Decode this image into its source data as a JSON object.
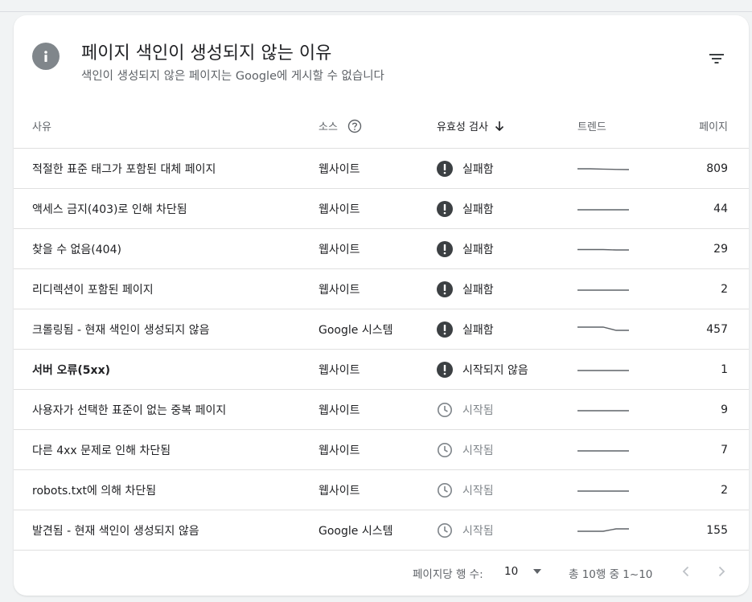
{
  "header": {
    "title": "페이지 색인이 생성되지 않는 이유",
    "subtitle": "색인이 생성되지 않은 페이지는 Google에 게시할 수 없습니다"
  },
  "columns": {
    "reason": "사유",
    "source": "소스",
    "validation": "유효성 검사",
    "trend": "트렌드",
    "pages": "페이지"
  },
  "rows": [
    {
      "reason": "적절한 표준 태그가 포함된 대체 페이지",
      "source": "웹사이트",
      "status": "실패함",
      "status_type": "failed",
      "pages": "809",
      "bold": false,
      "trend": [
        5,
        5,
        5.4,
        5.8,
        6
      ]
    },
    {
      "reason": "액세스 금지(403)로 인해 차단됨",
      "source": "웹사이트",
      "status": "실패함",
      "status_type": "failed",
      "pages": "44",
      "bold": false,
      "trend": [
        6,
        6,
        6,
        6,
        6
      ]
    },
    {
      "reason": "찾을 수 없음(404)",
      "source": "웹사이트",
      "status": "실패함",
      "status_type": "failed",
      "pages": "29",
      "bold": false,
      "trend": [
        5.5,
        5.5,
        5.5,
        6,
        6
      ]
    },
    {
      "reason": "리디렉션이 포함된 페이지",
      "source": "웹사이트",
      "status": "실패함",
      "status_type": "failed",
      "pages": "2",
      "bold": false,
      "trend": [
        6,
        6,
        6,
        6,
        6
      ]
    },
    {
      "reason": "크롤링됨 - 현재 색인이 생성되지 않음",
      "source": "Google 시스템",
      "status": "실패함",
      "status_type": "failed",
      "pages": "457",
      "bold": false,
      "trend": [
        2,
        2,
        2,
        6,
        6
      ]
    },
    {
      "reason": "서버 오류(5xx)",
      "source": "웹사이트",
      "status": "시작되지 않음",
      "status_type": "not_started",
      "pages": "1",
      "bold": true,
      "trend": [
        6,
        6,
        6,
        6,
        6
      ]
    },
    {
      "reason": "사용자가 선택한 표준이 없는 중복 페이지",
      "source": "웹사이트",
      "status": "시작됨",
      "status_type": "started",
      "pages": "9",
      "bold": false,
      "trend": [
        6,
        6,
        6,
        6,
        6
      ]
    },
    {
      "reason": "다른 4xx 문제로 인해 차단됨",
      "source": "웹사이트",
      "status": "시작됨",
      "status_type": "started",
      "pages": "7",
      "bold": false,
      "trend": [
        6,
        6,
        6,
        6,
        6
      ]
    },
    {
      "reason": "robots.txt에 의해 차단됨",
      "source": "웹사이트",
      "status": "시작됨",
      "status_type": "started",
      "pages": "2",
      "bold": false,
      "trend": [
        6,
        6,
        6,
        6,
        6
      ]
    },
    {
      "reason": "발견됨 - 현재 색인이 생성되지 않음",
      "source": "Google 시스템",
      "status": "시작됨",
      "status_type": "started",
      "pages": "155",
      "bold": false,
      "trend": [
        6,
        6,
        6,
        3,
        3
      ]
    }
  ],
  "footer": {
    "rows_per_page_label": "페이지당 행 수:",
    "rows_per_page_value": "10",
    "range_text": "총 10행 중 1~10"
  },
  "colors": {
    "failed_icon": "#3c4043",
    "started_icon": "#80868b",
    "trend_line": "#5f6368"
  },
  "icons": {
    "header": "info-icon",
    "filter": "filter-icon",
    "source_help": "help-icon",
    "sort": "arrow-down-icon",
    "failed": "error-icon",
    "started": "clock-icon",
    "dropdown": "caret-down-icon",
    "prev": "chevron-left-icon",
    "next": "chevron-right-icon"
  }
}
